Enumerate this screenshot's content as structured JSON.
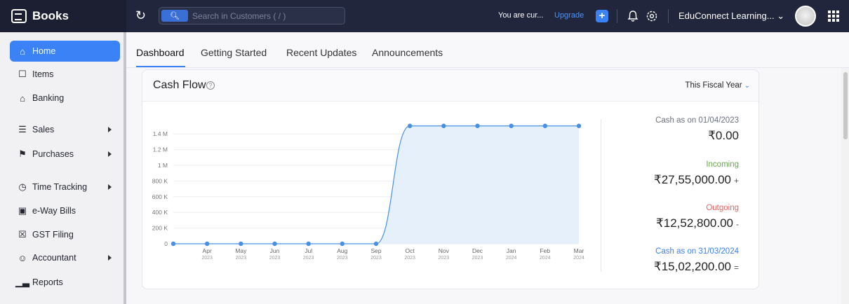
{
  "app": {
    "name": "Books"
  },
  "search": {
    "scope_icon": "search-icon",
    "placeholder": "Search in Customers ( / )"
  },
  "topbar": {
    "notice": "You are cur...",
    "upgrade_label": "Upgrade",
    "org_name": "EduConnect Learning...",
    "plus_label": "+",
    "org_caret": "⌄"
  },
  "sidebar": {
    "items": [
      {
        "label": "Home",
        "icon": "home-icon",
        "active": true
      },
      {
        "label": "Items",
        "icon": "box-icon"
      },
      {
        "label": "Banking",
        "icon": "bank-icon"
      },
      {
        "label": "Sales",
        "icon": "cart-icon",
        "expandable": true
      },
      {
        "label": "Purchases",
        "icon": "bag-icon",
        "expandable": true
      },
      {
        "label": "Time Tracking",
        "icon": "timer-icon",
        "expandable": true
      },
      {
        "label": "e-Way Bills",
        "icon": "truck-icon"
      },
      {
        "label": "GST Filing",
        "icon": "gst-icon"
      },
      {
        "label": "Accountant",
        "icon": "accountant-icon",
        "expandable": true
      },
      {
        "label": "Reports",
        "icon": "reports-icon"
      }
    ]
  },
  "tabs": [
    {
      "label": "Dashboard",
      "active": true
    },
    {
      "label": "Getting Started"
    },
    {
      "label": "Recent Updates"
    },
    {
      "label": "Announcements"
    }
  ],
  "card": {
    "title": "Cash Flow",
    "help_icon": "help-circle-icon",
    "period": "This Fiscal Year",
    "period_caret": "⌄"
  },
  "summary": {
    "opening": {
      "label": "Cash as on 01/04/2023",
      "value": "₹0.00",
      "sign": "",
      "color": "#6b7280"
    },
    "incoming": {
      "label": "Incoming",
      "value": "₹27,55,000.00",
      "sign": "+",
      "color": "#6aa84f"
    },
    "outgoing": {
      "label": "Outgoing",
      "value": "₹12,52,800.00",
      "sign": "-",
      "color": "#e06666"
    },
    "closing": {
      "label": "Cash as on 31/03/2024",
      "value": "₹15,02,200.00",
      "sign": "=",
      "color": "#3b82f6"
    }
  },
  "chart_data": {
    "type": "area",
    "x": [
      "",
      "Apr",
      "May",
      "Jun",
      "Jul",
      "Aug",
      "Sep",
      "Oct",
      "Nov",
      "Dec",
      "Jan",
      "Feb",
      "Mar"
    ],
    "x_sub": [
      "",
      "2023",
      "2023",
      "2023",
      "2023",
      "2023",
      "2023",
      "2023",
      "2023",
      "2023",
      "2024",
      "2024",
      "2024"
    ],
    "values": [
      0,
      0,
      0,
      0,
      0,
      0,
      0,
      1502200,
      1502200,
      1502200,
      1502200,
      1502200,
      1502200
    ],
    "ylim": [
      0,
      1500000
    ],
    "y_ticks": [
      0,
      200000,
      400000,
      600000,
      800000,
      1000000,
      1200000,
      1400000
    ],
    "y_tick_labels": [
      "0",
      "200 K",
      "400 K",
      "600 K",
      "800 K",
      "1 M",
      "1.2 M",
      "1.4 M"
    ],
    "colors": {
      "line": "#4a90e2",
      "fill": "#e6f0fb",
      "grid": "#eeeeee"
    },
    "grid": true
  }
}
